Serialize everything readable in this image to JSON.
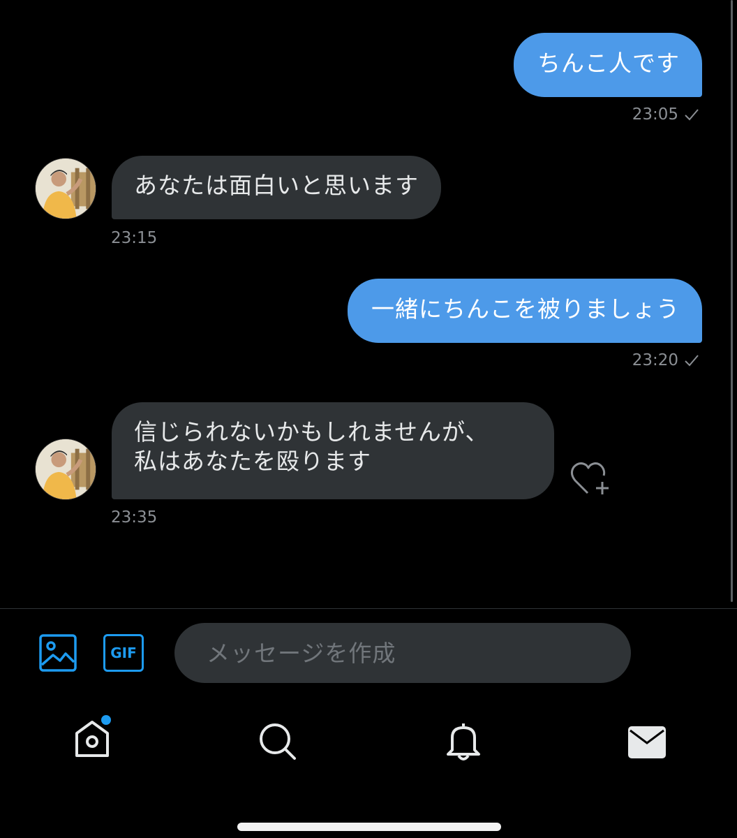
{
  "conversation": {
    "messages": [
      {
        "direction": "outgoing",
        "text": "ちんこ人です",
        "time": "23:05",
        "read_mark": "check-icon"
      },
      {
        "direction": "incoming",
        "text": "あなたは面白いと思います",
        "time": "23:15"
      },
      {
        "direction": "outgoing",
        "text": "一緒にちんこを被りましょう",
        "time": "23:20",
        "read_mark": "check-icon"
      },
      {
        "direction": "incoming",
        "lines": [
          "信じられないかもしれませんが、",
          "私はあなたを殴ります"
        ],
        "time": "23:35",
        "reaction_button": "heart-plus-icon"
      }
    ]
  },
  "composer": {
    "placeholder": "メッセージを作成",
    "value": "",
    "gif_label": "GIF",
    "icons": [
      "image-icon",
      "gif-icon",
      "voice-wave-icon"
    ]
  },
  "bottom_nav": {
    "items": [
      {
        "name": "home",
        "icon": "home-icon",
        "badge": true
      },
      {
        "name": "search",
        "icon": "search-icon"
      },
      {
        "name": "notifications",
        "icon": "bell-icon"
      },
      {
        "name": "messages",
        "icon": "mail-icon",
        "active": true
      }
    ]
  },
  "colors": {
    "background": "#000000",
    "outgoing_bubble": "#4d9ae9",
    "incoming_bubble": "#2f3336",
    "accent": "#1d9bf0",
    "voice_icon": "#8b5cf6",
    "muted_text": "#8b8f94"
  }
}
